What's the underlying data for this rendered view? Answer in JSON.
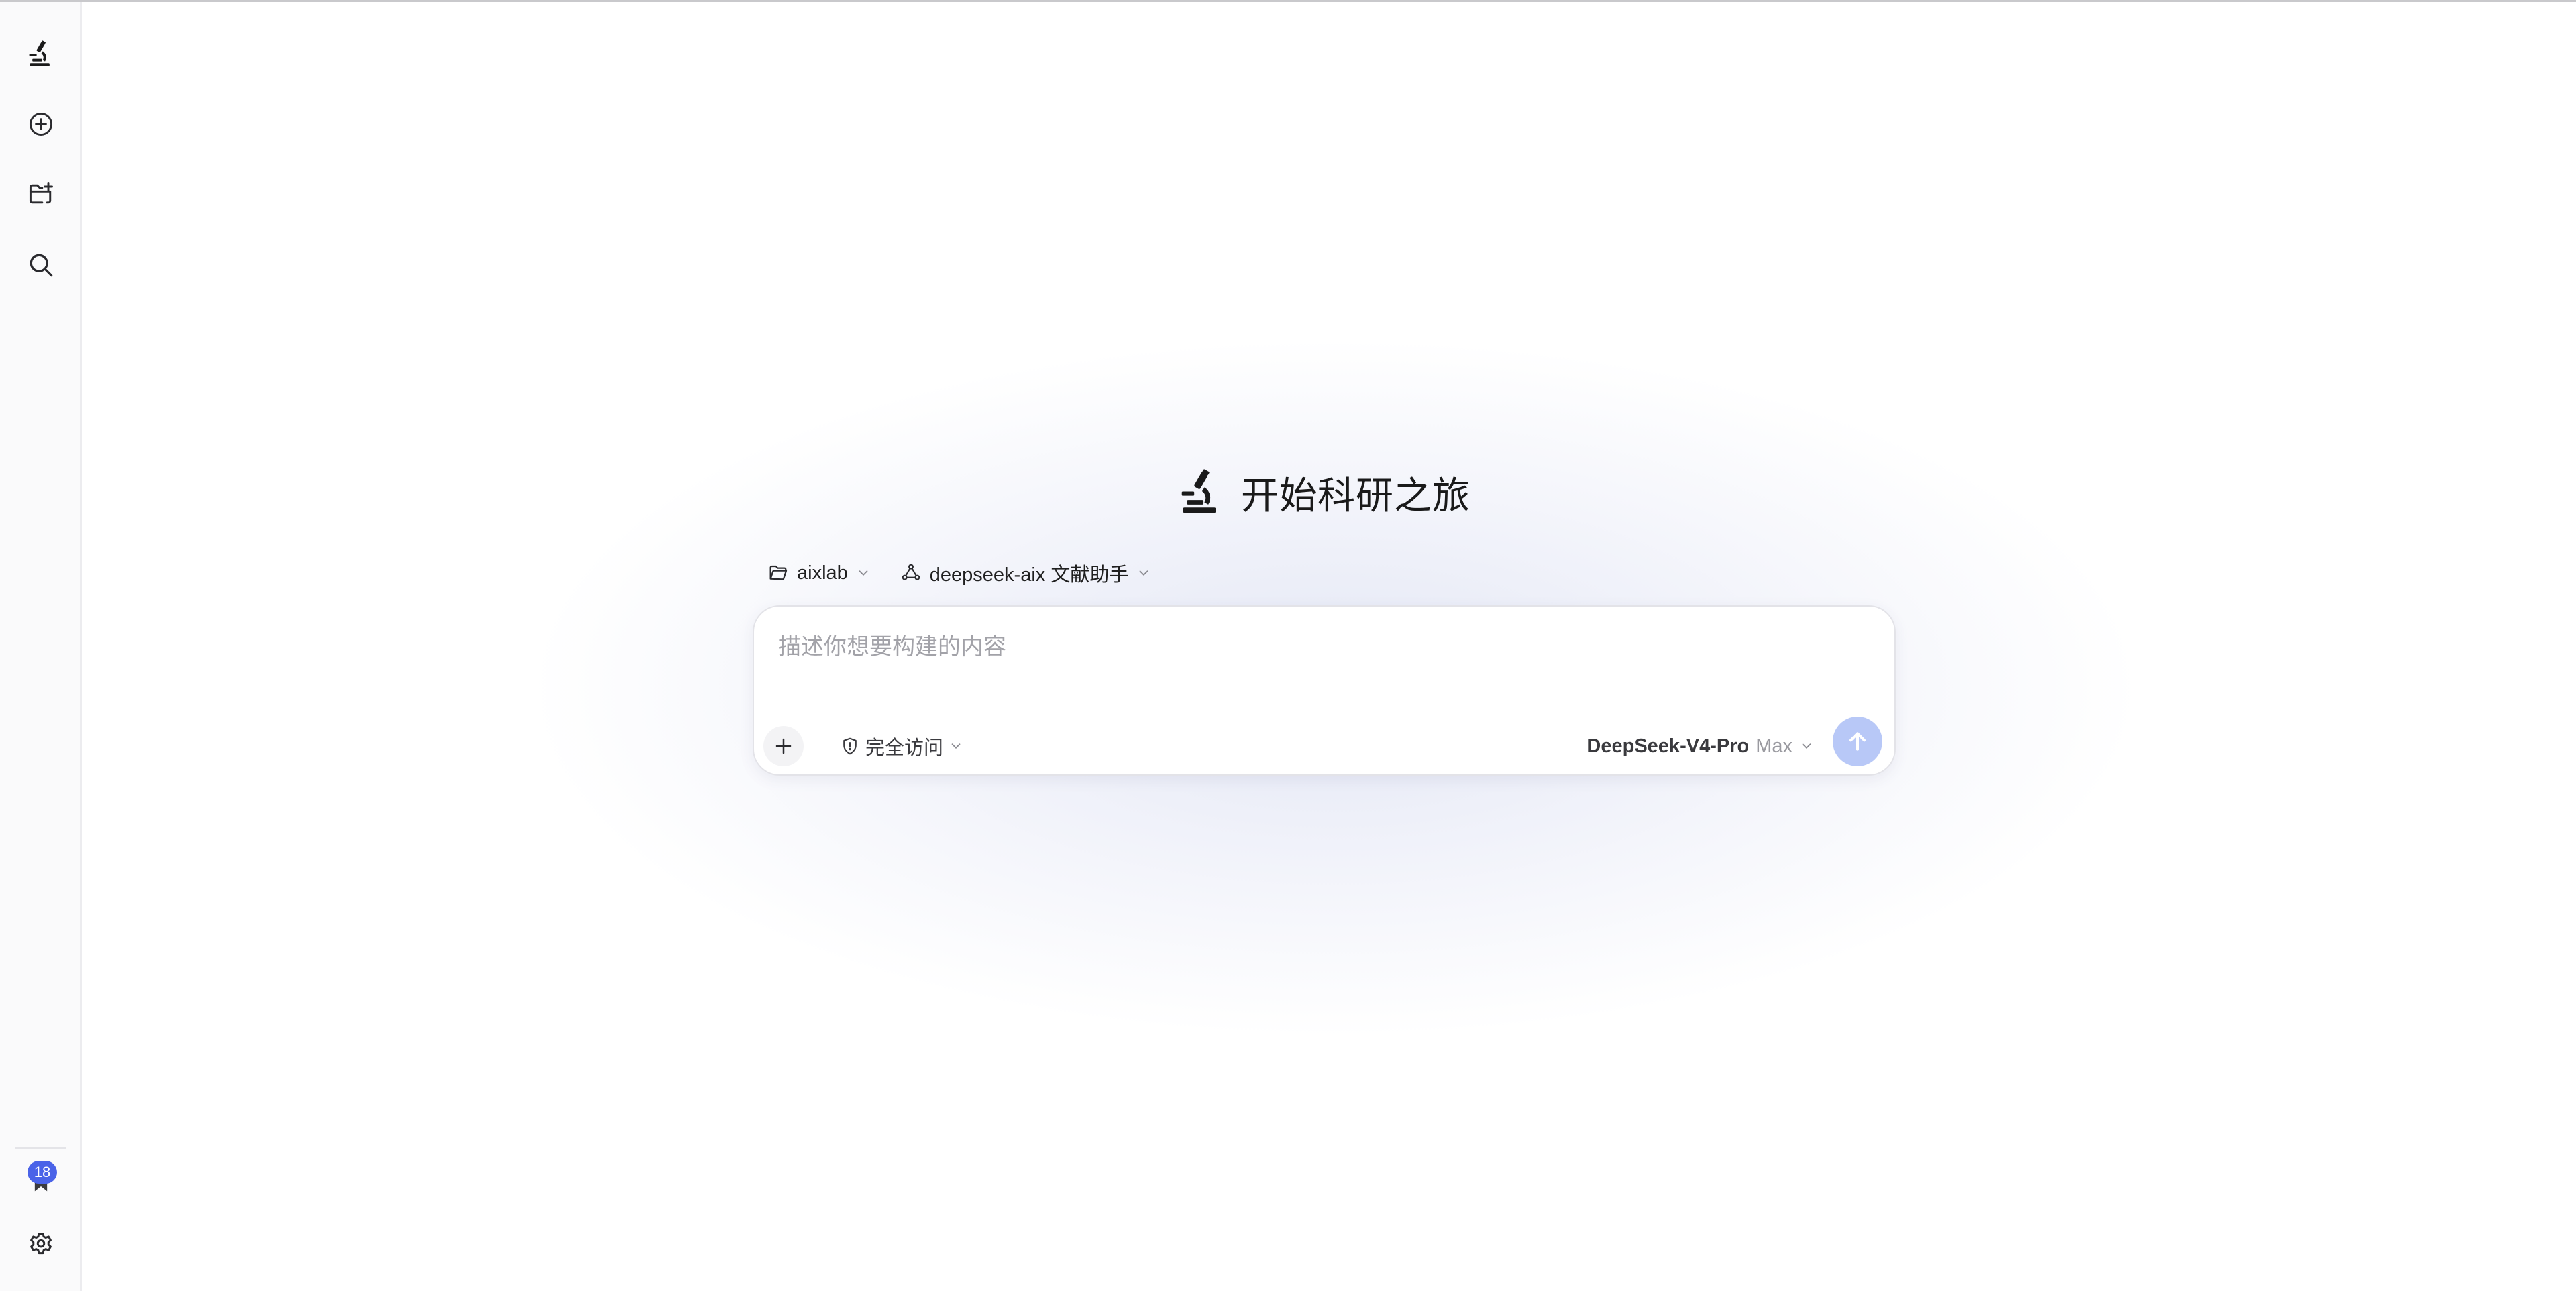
{
  "sidebar": {
    "items": [
      {
        "name": "logo-microscope-icon",
        "icon": "microscope-icon"
      },
      {
        "name": "new-chat-button",
        "icon": "plus-circle-icon"
      },
      {
        "name": "new-project-button",
        "icon": "folder-plus-icon"
      },
      {
        "name": "search-button",
        "icon": "search-icon"
      }
    ],
    "badge_count": "18",
    "badge_icon": "award-ribbon-icon",
    "settings_icon": "gear-icon"
  },
  "hero": {
    "icon": "microscope-icon",
    "title": "开始科研之旅"
  },
  "context": {
    "folder_icon": "folder-icon",
    "folder_label": "aixlab",
    "agent_icon": "agent-icon",
    "agent_label": "deepseek-aix 文献助手"
  },
  "composer": {
    "placeholder": "描述你想要构建的内容",
    "value": "",
    "attach_icon": "plus-icon",
    "access_icon": "shield-icon",
    "access_label": "完全访问",
    "model_name": "DeepSeek-V4-Pro",
    "model_tier": "Max",
    "send_icon": "arrow-up-icon"
  },
  "colors": {
    "accent": "#4a63e8",
    "send_button": "#b8c8f7",
    "sidebar_bg": "#fafafb",
    "placeholder": "#a2a2a8"
  }
}
